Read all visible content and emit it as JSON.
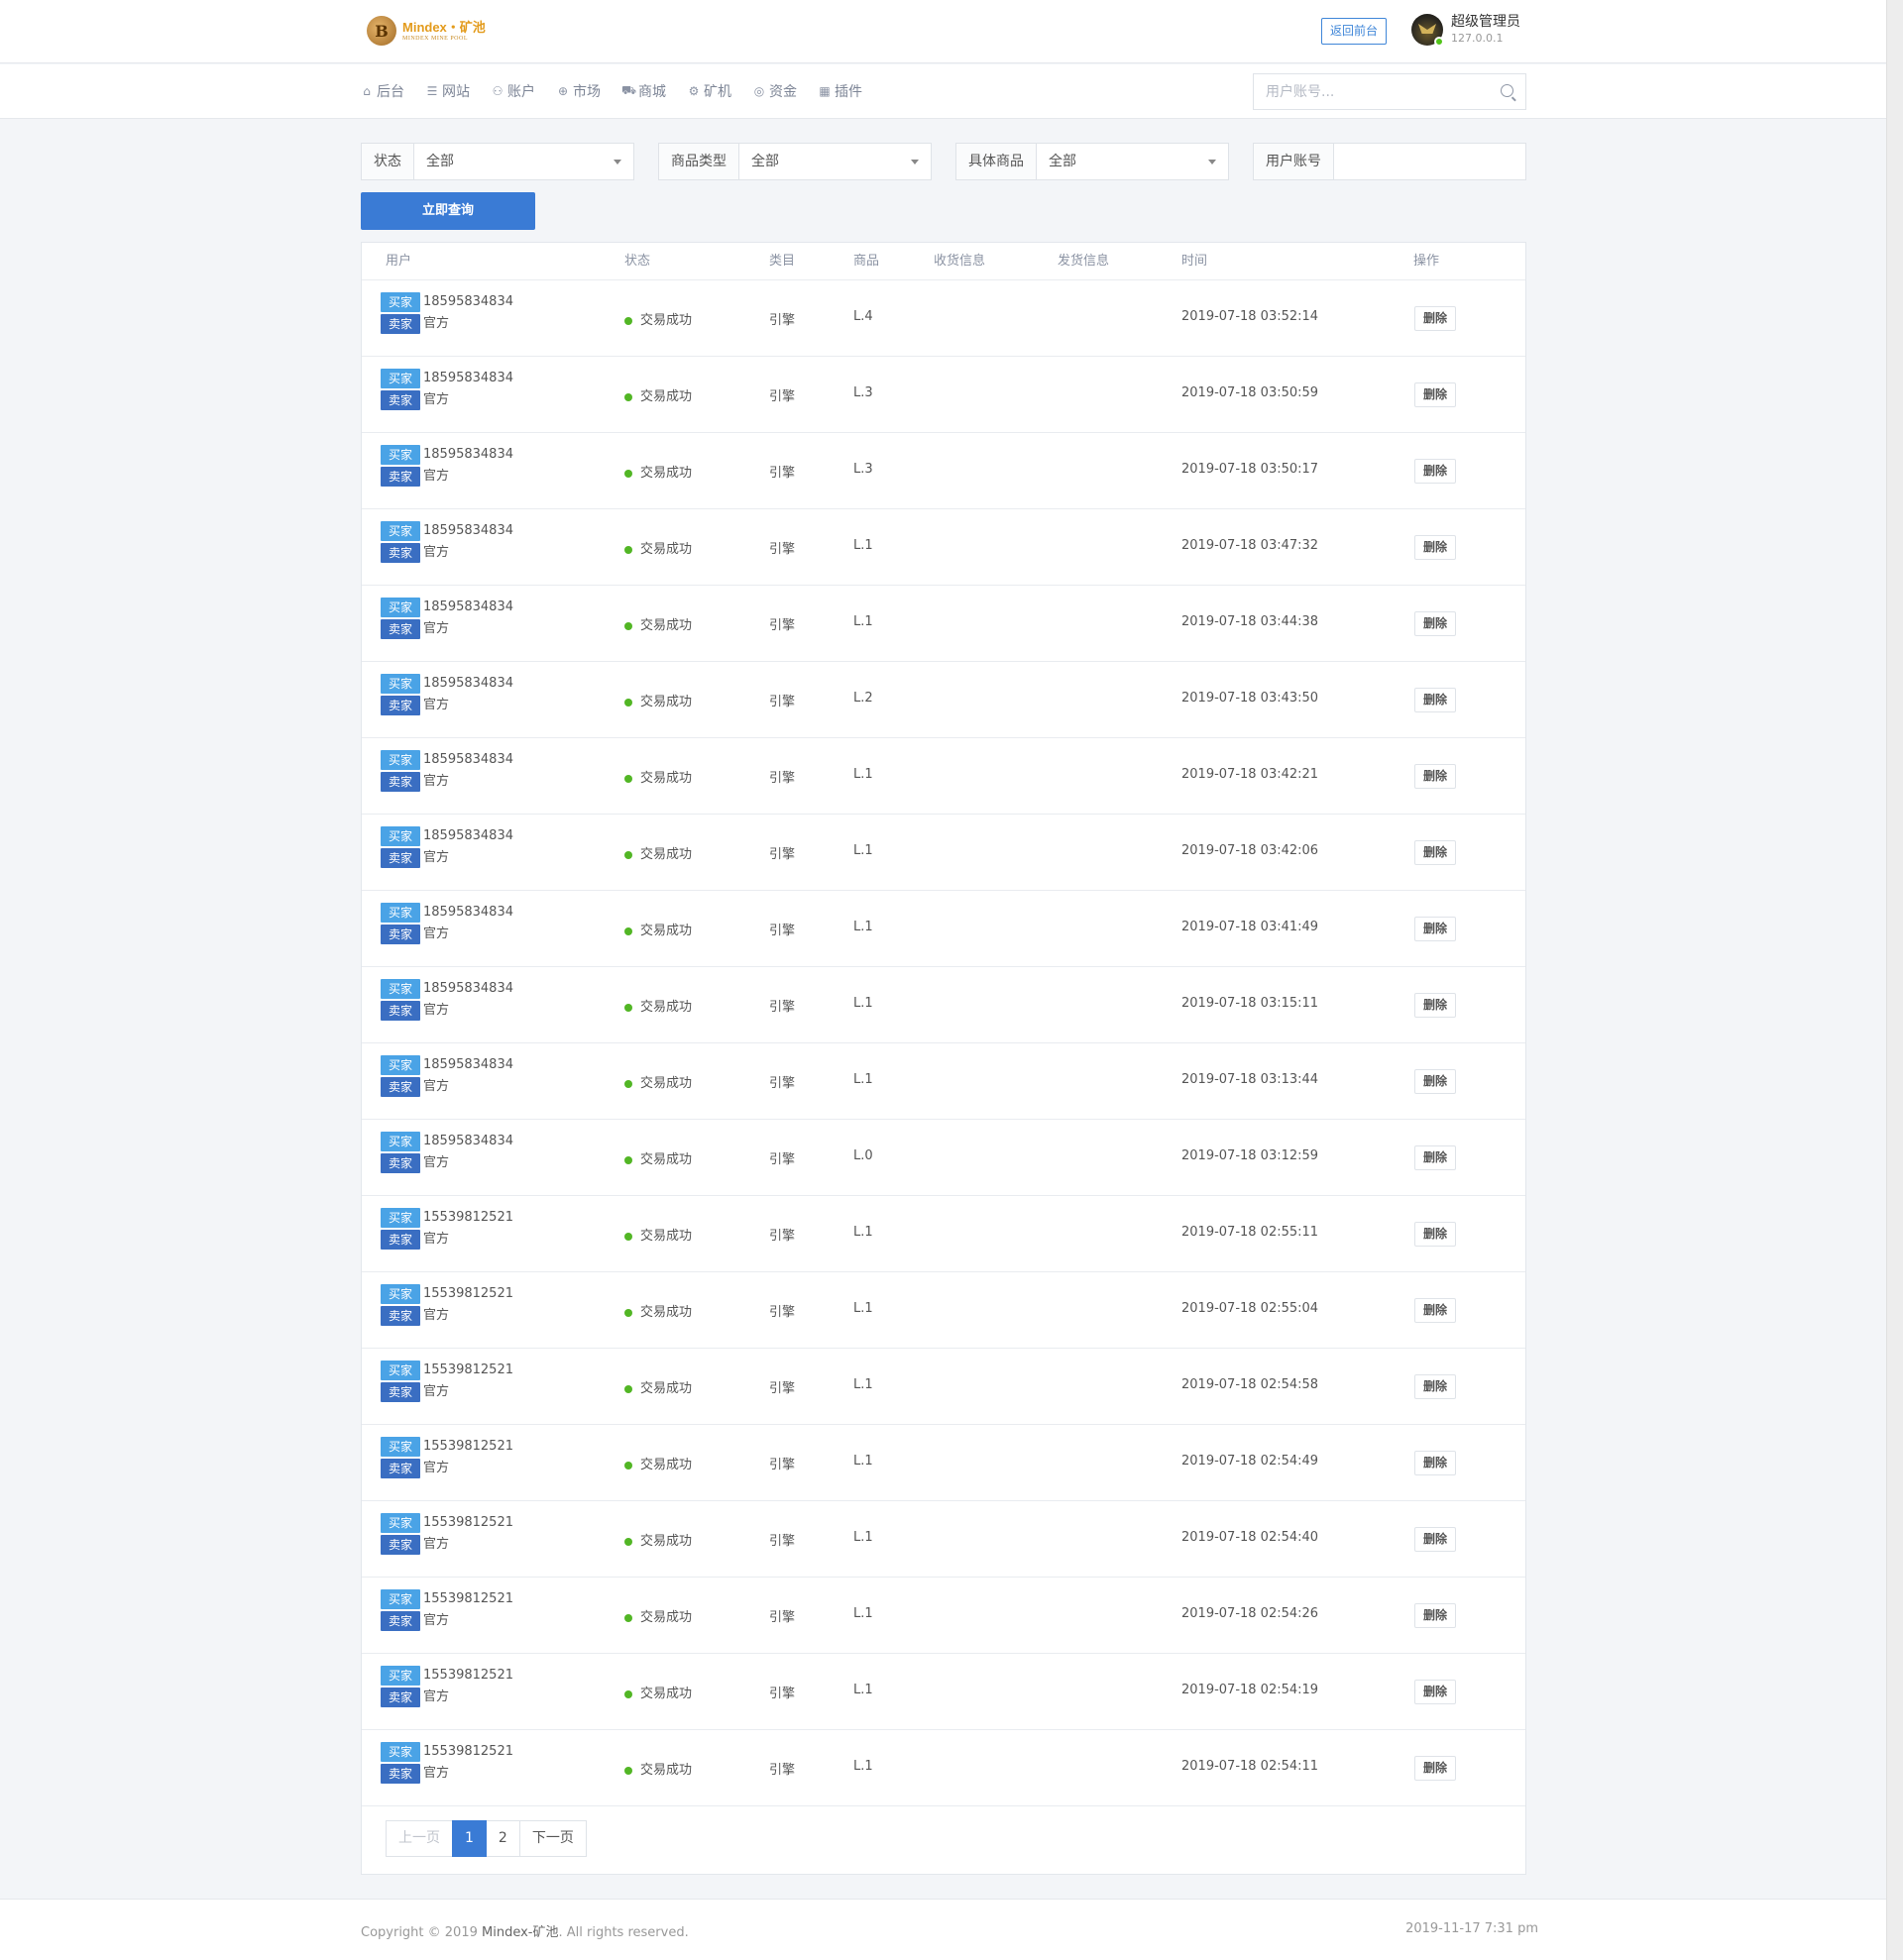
{
  "header": {
    "logo_title": "Mindex・矿池",
    "logo_subtitle": "MINDEX MINE POOL",
    "logo_glyph": "B",
    "back_button": "返回前台",
    "user_name": "超级管理员",
    "user_ip": "127.0.0.1"
  },
  "nav": {
    "items": [
      {
        "icon": "home-icon",
        "glyph": "⌂",
        "label": "后台"
      },
      {
        "icon": "list-icon",
        "glyph": "☰",
        "label": "网站"
      },
      {
        "icon": "users-icon",
        "glyph": "⚇",
        "label": "账户"
      },
      {
        "icon": "globe-icon",
        "glyph": "⊕",
        "label": "市场"
      },
      {
        "icon": "cart-icon",
        "glyph": "⛟",
        "label": "商城"
      },
      {
        "icon": "gear-icon",
        "glyph": "⚙",
        "label": "矿机"
      },
      {
        "icon": "coin-icon",
        "glyph": "◎",
        "label": "资金"
      },
      {
        "icon": "grid-icon",
        "glyph": "▦",
        "label": "插件"
      }
    ],
    "search_placeholder": "用户账号..."
  },
  "filters": {
    "status_label": "状态",
    "status_value": "全部",
    "category_label": "商品类型",
    "category_value": "全部",
    "product_label": "具体商品",
    "product_value": "全部",
    "account_label": "用户账号",
    "account_value": "",
    "query_button": "立即查询"
  },
  "table": {
    "headers": {
      "user": "用户",
      "status": "状态",
      "category": "类目",
      "product": "商品",
      "receive": "收货信息",
      "ship": "发货信息",
      "time": "时间",
      "action": "操作"
    },
    "buyer_tag": "买家",
    "seller_tag": "卖家",
    "delete_label": "删除",
    "rows": [
      {
        "buyer": "18595834834",
        "seller": "官方",
        "status": "交易成功",
        "category": "引擎",
        "product": "L.4",
        "receive": "",
        "ship": "",
        "time": "2019-07-18 03:52:14"
      },
      {
        "buyer": "18595834834",
        "seller": "官方",
        "status": "交易成功",
        "category": "引擎",
        "product": "L.3",
        "receive": "",
        "ship": "",
        "time": "2019-07-18 03:50:59"
      },
      {
        "buyer": "18595834834",
        "seller": "官方",
        "status": "交易成功",
        "category": "引擎",
        "product": "L.3",
        "receive": "",
        "ship": "",
        "time": "2019-07-18 03:50:17"
      },
      {
        "buyer": "18595834834",
        "seller": "官方",
        "status": "交易成功",
        "category": "引擎",
        "product": "L.1",
        "receive": "",
        "ship": "",
        "time": "2019-07-18 03:47:32"
      },
      {
        "buyer": "18595834834",
        "seller": "官方",
        "status": "交易成功",
        "category": "引擎",
        "product": "L.1",
        "receive": "",
        "ship": "",
        "time": "2019-07-18 03:44:38"
      },
      {
        "buyer": "18595834834",
        "seller": "官方",
        "status": "交易成功",
        "category": "引擎",
        "product": "L.2",
        "receive": "",
        "ship": "",
        "time": "2019-07-18 03:43:50"
      },
      {
        "buyer": "18595834834",
        "seller": "官方",
        "status": "交易成功",
        "category": "引擎",
        "product": "L.1",
        "receive": "",
        "ship": "",
        "time": "2019-07-18 03:42:21"
      },
      {
        "buyer": "18595834834",
        "seller": "官方",
        "status": "交易成功",
        "category": "引擎",
        "product": "L.1",
        "receive": "",
        "ship": "",
        "time": "2019-07-18 03:42:06"
      },
      {
        "buyer": "18595834834",
        "seller": "官方",
        "status": "交易成功",
        "category": "引擎",
        "product": "L.1",
        "receive": "",
        "ship": "",
        "time": "2019-07-18 03:41:49"
      },
      {
        "buyer": "18595834834",
        "seller": "官方",
        "status": "交易成功",
        "category": "引擎",
        "product": "L.1",
        "receive": "",
        "ship": "",
        "time": "2019-07-18 03:15:11"
      },
      {
        "buyer": "18595834834",
        "seller": "官方",
        "status": "交易成功",
        "category": "引擎",
        "product": "L.1",
        "receive": "",
        "ship": "",
        "time": "2019-07-18 03:13:44"
      },
      {
        "buyer": "18595834834",
        "seller": "官方",
        "status": "交易成功",
        "category": "引擎",
        "product": "L.0",
        "receive": "",
        "ship": "",
        "time": "2019-07-18 03:12:59"
      },
      {
        "buyer": "15539812521",
        "seller": "官方",
        "status": "交易成功",
        "category": "引擎",
        "product": "L.1",
        "receive": "",
        "ship": "",
        "time": "2019-07-18 02:55:11"
      },
      {
        "buyer": "15539812521",
        "seller": "官方",
        "status": "交易成功",
        "category": "引擎",
        "product": "L.1",
        "receive": "",
        "ship": "",
        "time": "2019-07-18 02:55:04"
      },
      {
        "buyer": "15539812521",
        "seller": "官方",
        "status": "交易成功",
        "category": "引擎",
        "product": "L.1",
        "receive": "",
        "ship": "",
        "time": "2019-07-18 02:54:58"
      },
      {
        "buyer": "15539812521",
        "seller": "官方",
        "status": "交易成功",
        "category": "引擎",
        "product": "L.1",
        "receive": "",
        "ship": "",
        "time": "2019-07-18 02:54:49"
      },
      {
        "buyer": "15539812521",
        "seller": "官方",
        "status": "交易成功",
        "category": "引擎",
        "product": "L.1",
        "receive": "",
        "ship": "",
        "time": "2019-07-18 02:54:40"
      },
      {
        "buyer": "15539812521",
        "seller": "官方",
        "status": "交易成功",
        "category": "引擎",
        "product": "L.1",
        "receive": "",
        "ship": "",
        "time": "2019-07-18 02:54:26"
      },
      {
        "buyer": "15539812521",
        "seller": "官方",
        "status": "交易成功",
        "category": "引擎",
        "product": "L.1",
        "receive": "",
        "ship": "",
        "time": "2019-07-18 02:54:19"
      },
      {
        "buyer": "15539812521",
        "seller": "官方",
        "status": "交易成功",
        "category": "引擎",
        "product": "L.1",
        "receive": "",
        "ship": "",
        "time": "2019-07-18 02:54:11"
      }
    ]
  },
  "pagination": {
    "prev": "上一页",
    "pages": [
      "1",
      "2"
    ],
    "current": "1",
    "next": "下一页"
  },
  "footer": {
    "copyright_prefix": "Copyright © 2019 ",
    "brand": "Mindex-矿池",
    "copyright_suffix": ". All rights reserved.",
    "time": "2019-11-17 7:31 pm"
  },
  "colors": {
    "primary": "#3a7bd5",
    "buyer_tag": "#4aa3e6",
    "seller_tag": "#3a6ec2",
    "status_success": "#52b625",
    "logo_gold": "#e39b1c"
  }
}
